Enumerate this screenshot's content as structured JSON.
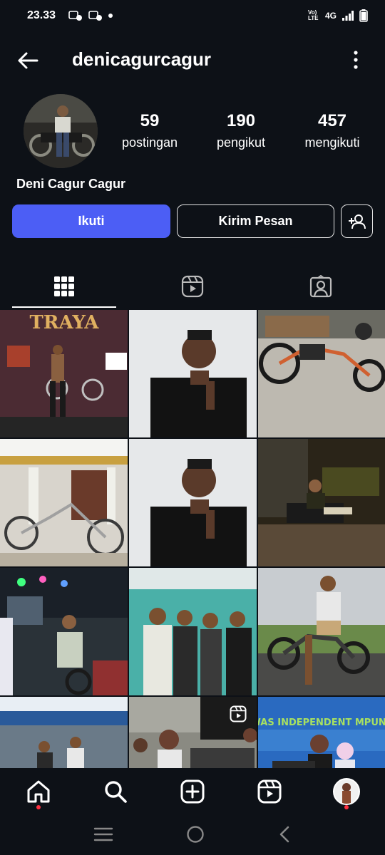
{
  "status": {
    "time": "23.33",
    "network": "4G",
    "volte": "Vo) LTE"
  },
  "header": {
    "username": "denicagurcagur"
  },
  "profile": {
    "display_name": "Deni Cagur Cagur",
    "stats": [
      {
        "value": "59",
        "label": "postingan"
      },
      {
        "value": "190",
        "label": "pengikut"
      },
      {
        "value": "457",
        "label": "mengikuti"
      }
    ]
  },
  "actions": {
    "follow_label": "Ikuti",
    "message_label": "Kirim Pesan"
  },
  "tabs": [
    "posts-grid-icon",
    "reels-icon",
    "tagged-icon"
  ],
  "grid": {
    "posts": [
      {
        "caption": "TRAYA"
      },
      {
        "caption": ""
      },
      {
        "caption": ""
      },
      {
        "caption": ""
      },
      {
        "caption": ""
      },
      {
        "caption": ""
      },
      {
        "caption": ""
      },
      {
        "caption": ""
      },
      {
        "caption": ""
      },
      {
        "caption": ""
      },
      {
        "caption": ""
      },
      {
        "caption": "WAS INDEPENDENT MPUNG"
      }
    ]
  },
  "colors": {
    "background": "#0d1117",
    "accent": "#4c5ef5",
    "notification": "#ff3040"
  }
}
